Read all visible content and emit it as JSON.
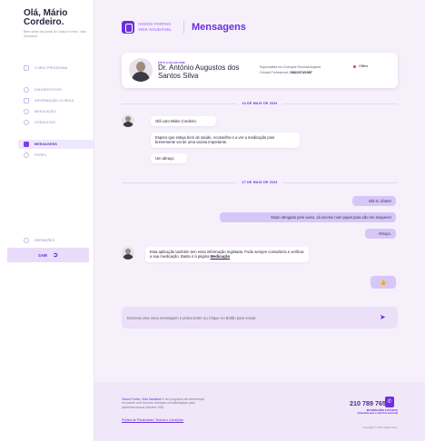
{
  "sidebar": {
    "greeting_title": "Olá, Mário Cordeiro.",
    "greeting_sub": "Bem-vindo ao portal do Ossos Fortes, Vida Saudável.",
    "items": [
      {
        "label": "O MEU PROGRAMA",
        "icon": "calendar-icon"
      },
      {
        "label": "DIAGNÓSTICOS",
        "icon": "stethoscope-icon"
      },
      {
        "label": "INFORMAÇÃO CLÍNICA",
        "icon": "clipboard-icon"
      },
      {
        "label": "MEDICAÇÃO",
        "icon": "pill-icon"
      },
      {
        "label": "CONSULTAS",
        "icon": "doctor-icon"
      },
      {
        "label": "MENSAGENS",
        "icon": "chat-icon"
      },
      {
        "label": "PERFIL",
        "icon": "user-icon"
      }
    ],
    "active_item": "MENSAGENS",
    "settings_label": "DEFINIÇÕES",
    "logout_label": "SAIR"
  },
  "header": {
    "logo_line1": "OSSOS FORTES",
    "logo_line2": "VIDA SAUDÁVEL",
    "title": "Mensagens"
  },
  "doctor": {
    "label": "ESTÁ A FALAR COM",
    "name": "Dr. António Augustos dos Santos Silva",
    "specialty": "Especialista em Doenças Reumatológicas",
    "license_label": "Cédula Profissional:",
    "license": "OM22374/1987",
    "status": "Offline",
    "status_color": "#e23b4d"
  },
  "conversation": {
    "date1": "24 DE MAIO DE 2023",
    "group1": [
      "Olá caro Mário Cordeiro.",
      "Espero que esteja bem de saúde. Aconselho-o a ver a medicação pois brevemente vai ter uma vacina importante.",
      "Um abraço."
    ],
    "date2": "27 DE MAIO DE 2023",
    "outgoing": [
      "Olá sr. doutor",
      "Muito obrigado pelo aviso. Já escrevi num papel para não me esquecer",
      "Abraço."
    ],
    "group2_text": "Esta aplicação também tem essa informação registada. Pode sempre consultá-la e verificar a sua medicação. Basta ir à página",
    "group2_link": "Medicação",
    "reaction": "👍"
  },
  "composer": {
    "placeholder": "Escreva uma nova mensagem e prima Enter ou Clique no Botão para enviar",
    "send_icon": "send-icon"
  },
  "footer": {
    "brand": "Ossos Fortes, Vida Saudável",
    "description": " é um programa de intervenção em saúde com foco em doenças reumatológicas para pacientes idosos (adultos +65).",
    "privacy_link": "Política de Privacidade",
    "separator": " | ",
    "terms_link": "Termos e Condições",
    "phone": "210 789 765",
    "phone_sub": "INFORMAÇÕES E DÚVIDAS",
    "phone_note": "(Chamada para a rede fixa nacional)",
    "copyright": "Copyright © 2023 Vasilly Dewu"
  },
  "colors": {
    "accent": "#6c2fd9",
    "background": "#f6f0fb",
    "outgoing_bubble": "#d9c6f9"
  }
}
